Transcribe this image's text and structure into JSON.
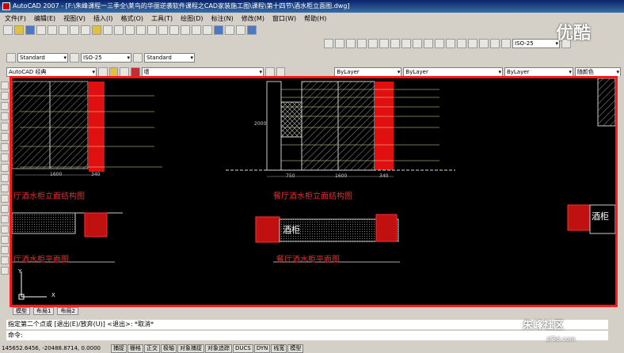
{
  "window": {
    "title": "AutoCAD 2007 - [F:\\朱峰课程一三季全\\莱鸟的华丽逆袭软件课程之CAD家装施工图\\课程\\第十四节\\酒水柜立面图.dwg]"
  },
  "menu": [
    "文件(F)",
    "编辑(E)",
    "视图(V)",
    "插入(I)",
    "格式(O)",
    "工具(T)",
    "绘图(D)",
    "标注(N)",
    "修改(M)",
    "窗口(W)",
    "帮助(H)"
  ],
  "toolbar_styles": {
    "text_style": "Standard",
    "dim_style": "ISO-25",
    "table_style": "Standard",
    "dim_style_right": "ISO-25"
  },
  "toolbar_layers": {
    "workspace": "AutoCAD 经典",
    "layer": "墙",
    "color": "ByLayer",
    "linetype": "ByLayer",
    "lineweight": "ByLayer",
    "plotstyle": "随颜色"
  },
  "drawing": {
    "titles": [
      "厅酒水柜立面结构图",
      "餐厅酒水柜立面结构图",
      "厅酒水柜平面图",
      "餐厅酒水柜平面图"
    ],
    "labels": [
      "酒柜",
      "酒柜"
    ],
    "dims": [
      "1600",
      "340",
      "750",
      "1600",
      "340",
      "2000"
    ],
    "axis_y": "Y",
    "axis_x": "X"
  },
  "layout_tabs": [
    "模型",
    "布局1",
    "布局2"
  ],
  "command": {
    "line1": "指定第二个点或 [退出(E)/放弃(U)] <退出>: *取消*",
    "prompt": "命令:"
  },
  "status": {
    "coords": "145652.6456, -20488.8714, 0.0000",
    "buttons": [
      "捕捉",
      "栅格",
      "正交",
      "极轴",
      "对象捕捉",
      "对象追踪",
      "DUCS",
      "DYN",
      "线宽",
      "模型"
    ]
  },
  "watermarks": {
    "youku": "优酷",
    "site": "朱峰社区",
    "url": "zf3d.com"
  },
  "colors": {
    "frame": "#ff1a1a",
    "canvas": "#000000",
    "wall_red": "#e01010",
    "hatch": "#c8c8c8"
  }
}
